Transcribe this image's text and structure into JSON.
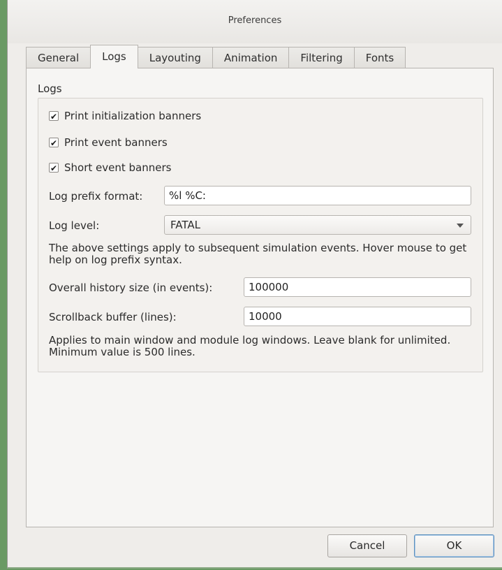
{
  "window": {
    "title": "Preferences"
  },
  "tabs": [
    {
      "label": "General",
      "active": false
    },
    {
      "label": "Logs",
      "active": true
    },
    {
      "label": "Layouting",
      "active": false
    },
    {
      "label": "Animation",
      "active": false
    },
    {
      "label": "Filtering",
      "active": false
    },
    {
      "label": "Fonts",
      "active": false
    }
  ],
  "logs": {
    "group_title": "Logs",
    "checkboxes": [
      {
        "label": "Print initialization banners",
        "checked": true
      },
      {
        "label": "Print event banners",
        "checked": true
      },
      {
        "label": "Short event banners",
        "checked": true
      }
    ],
    "check_glyph": "✔",
    "prefix_label": "Log prefix format:",
    "prefix_value": "%l %C:",
    "level_label": "Log level:",
    "level_value": "FATAL",
    "note1": "The above settings apply to subsequent simulation events. Hover mouse to get help on log prefix syntax.",
    "history_label": "Overall history size (in events):",
    "history_value": "100000",
    "scrollback_label": "Scrollback buffer (lines):",
    "scrollback_value": "10000",
    "note2": "Applies to main window and module log windows. Leave blank for unlimited. Minimum value is 500 lines."
  },
  "buttons": {
    "cancel": "Cancel",
    "ok": "OK"
  },
  "colors": {
    "desktop": "#6a9a64",
    "window_bg": "#efedea",
    "default_button_border": "#5b8fbd"
  }
}
